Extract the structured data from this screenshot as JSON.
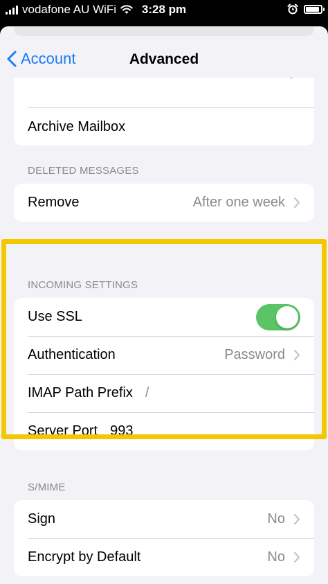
{
  "status_bar": {
    "carrier": "vodafone AU WiFi",
    "time": "3:28 pm",
    "icons": [
      "signal-icon",
      "wifi-icon",
      "alarm-icon",
      "battery-icon"
    ]
  },
  "nav": {
    "back_label": "Account",
    "title": "Advanced"
  },
  "archive": {
    "row_label": "Archive Mailbox"
  },
  "deleted_messages": {
    "header": "DELETED MESSAGES",
    "remove_label": "Remove",
    "remove_value": "After one week"
  },
  "incoming_settings": {
    "header": "INCOMING SETTINGS",
    "use_ssl_label": "Use SSL",
    "use_ssl_on": true,
    "authentication_label": "Authentication",
    "authentication_value": "Password",
    "imap_path_label": "IMAP Path Prefix",
    "imap_path_value": "/",
    "server_port_label": "Server Port",
    "server_port_value": "993"
  },
  "smime": {
    "header": "S/MIME",
    "sign_label": "Sign",
    "sign_value": "No",
    "encrypt_label": "Encrypt by Default",
    "encrypt_value": "No"
  },
  "colors": {
    "accent": "#1a7cf6",
    "toggle_on": "#5bc466",
    "highlight": "#f4c800",
    "background": "#f2f2f7"
  }
}
